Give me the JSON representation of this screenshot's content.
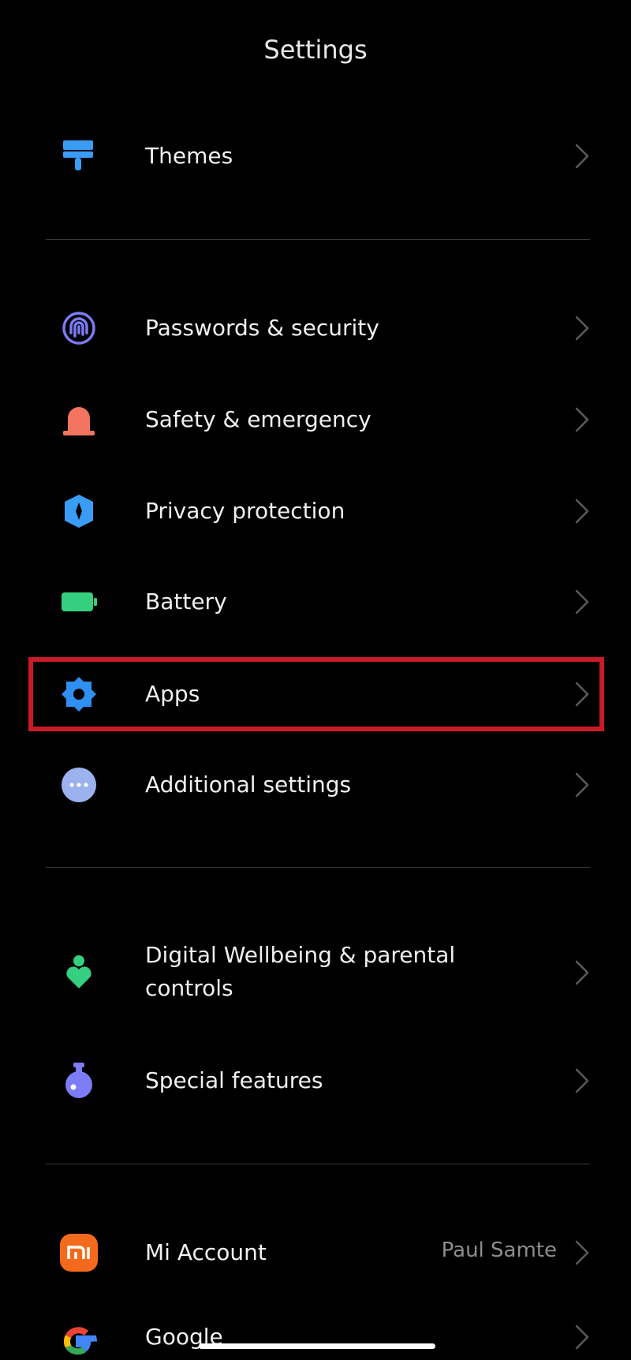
{
  "header": {
    "title": "Settings"
  },
  "items": [
    {
      "label": "Themes",
      "icon": "paint-brush-icon",
      "color": "#3a9cf4"
    },
    {
      "label": "Passwords & security",
      "icon": "fingerprint-icon",
      "color": "#7b7cf6"
    },
    {
      "label": "Safety & emergency",
      "icon": "siren-icon",
      "color": "#f3755f"
    },
    {
      "label": "Privacy protection",
      "icon": "shield-icon",
      "color": "#3a9cf4"
    },
    {
      "label": "Battery",
      "icon": "battery-icon",
      "color": "#35d07f"
    },
    {
      "label": "Apps",
      "icon": "gear-icon",
      "color": "#2f90f1",
      "highlighted": true
    },
    {
      "label": "Additional settings",
      "icon": "more-dots-icon",
      "color": "#9bb2ee"
    },
    {
      "label": "Digital Wellbeing & parental controls",
      "icon": "wellbeing-icon",
      "color": "#35d07f"
    },
    {
      "label": "Special features",
      "icon": "potion-icon",
      "color": "#7b7cf6"
    },
    {
      "label": "Mi Account",
      "value": "Paul Samte",
      "icon": "mi-logo-icon",
      "color": "#f46a1c"
    },
    {
      "label": "Google",
      "icon": "google-logo-icon"
    }
  ],
  "colors": {
    "background": "#000000",
    "highlight_border": "#c81a27",
    "divider": "#3a3a3a",
    "chevron": "#5a5a5a"
  }
}
